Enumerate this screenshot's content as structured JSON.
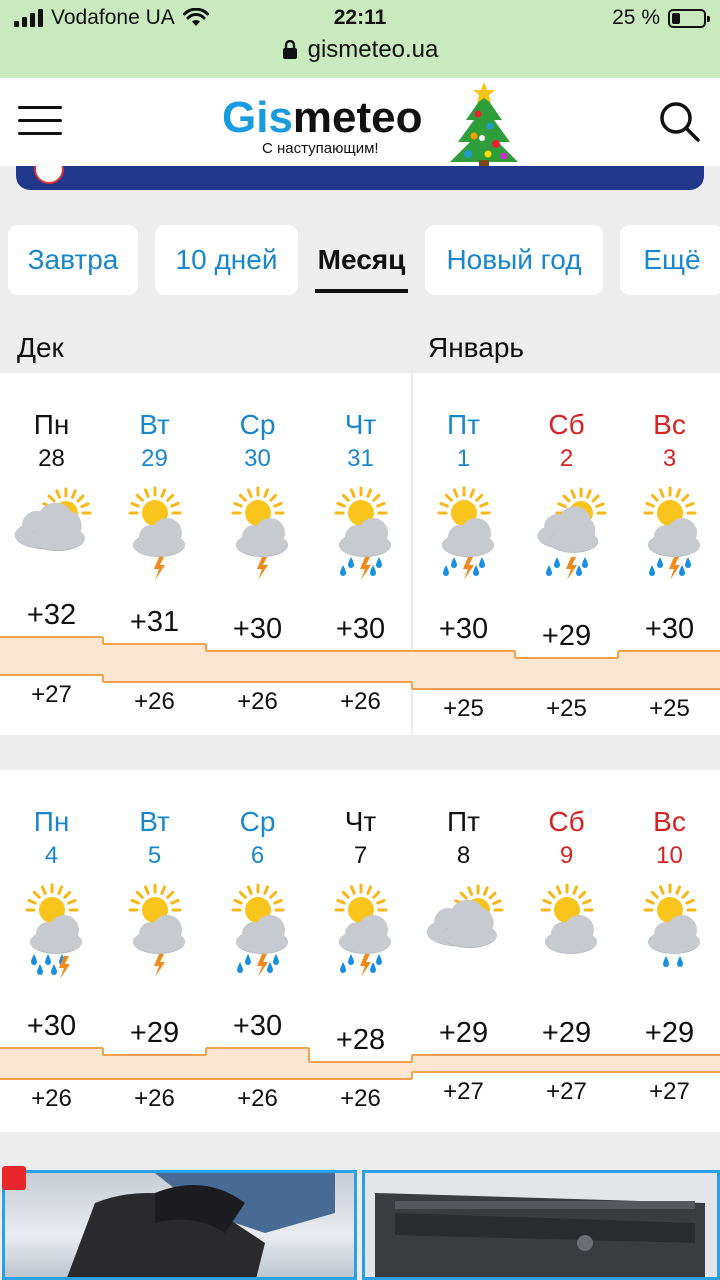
{
  "status_bar": {
    "carrier": "Vodafone UA",
    "time": "22:11",
    "battery": "25 %",
    "url": "gismeteo.ua",
    "wifi_icon": "wifi-icon",
    "lock_icon": "lock-icon"
  },
  "header": {
    "logo_part1": "Gis",
    "logo_part2": "meteo",
    "tagline": "С наступающим!",
    "menu_icon": "hamburger-icon",
    "search_icon": "search-icon"
  },
  "tabs": [
    {
      "label": "Завтра",
      "active": false
    },
    {
      "label": "10 дней",
      "active": false
    },
    {
      "label": "Месяц",
      "active": true
    },
    {
      "label": "Новый год",
      "active": false
    },
    {
      "label": "Ещё",
      "active": false
    }
  ],
  "months": {
    "left": "Дек",
    "right": "Январь"
  },
  "weeks": [
    {
      "days": [
        {
          "dow": "Пн",
          "num": "28",
          "kind": "past",
          "icon": "partly-cloudy",
          "max": "+32",
          "min": "+27"
        },
        {
          "dow": "Вт",
          "num": "29",
          "kind": "weekday",
          "icon": "thunderstorm",
          "max": "+31",
          "min": "+26"
        },
        {
          "dow": "Ср",
          "num": "30",
          "kind": "weekday",
          "icon": "thunderstorm",
          "max": "+30",
          "min": "+26"
        },
        {
          "dow": "Чт",
          "num": "31",
          "kind": "weekday",
          "icon": "thunderstorm-rain",
          "max": "+30",
          "min": "+26"
        },
        {
          "dow": "Пт",
          "num": "1",
          "kind": "weekday",
          "icon": "thunderstorm-rain",
          "max": "+30",
          "min": "+25"
        },
        {
          "dow": "Сб",
          "num": "2",
          "kind": "weekend",
          "icon": "cloudy-thunderstorm-rain",
          "max": "+29",
          "min": "+25"
        },
        {
          "dow": "Вс",
          "num": "3",
          "kind": "weekend",
          "icon": "thunderstorm-rain",
          "max": "+30",
          "min": "+25"
        }
      ]
    },
    {
      "days": [
        {
          "dow": "Пн",
          "num": "4",
          "kind": "weekday",
          "icon": "rain-thunder",
          "max": "+30",
          "min": "+26"
        },
        {
          "dow": "Вт",
          "num": "5",
          "kind": "weekday",
          "icon": "thunderstorm",
          "max": "+29",
          "min": "+26"
        },
        {
          "dow": "Ср",
          "num": "6",
          "kind": "weekday",
          "icon": "thunderstorm-rain",
          "max": "+30",
          "min": "+26"
        },
        {
          "dow": "Чт",
          "num": "7",
          "kind": "past",
          "icon": "thunderstorm-rain",
          "max": "+28",
          "min": "+26"
        },
        {
          "dow": "Пт",
          "num": "8",
          "kind": "past",
          "icon": "partly-cloudy",
          "max": "+29",
          "min": "+27"
        },
        {
          "dow": "Сб",
          "num": "9",
          "kind": "weekend",
          "icon": "sun-cloud",
          "max": "+29",
          "min": "+27"
        },
        {
          "dow": "Вс",
          "num": "10",
          "kind": "weekend",
          "icon": "light-rain",
          "max": "+29",
          "min": "+27"
        }
      ]
    }
  ],
  "colors": {
    "brand_blue": "#1a9be0",
    "link_blue": "#1a87cc",
    "weekend_red": "#d62222",
    "temp_band": "#fde6d2",
    "temp_line": "#f5a04a",
    "ad_border": "#2aa0e6"
  }
}
